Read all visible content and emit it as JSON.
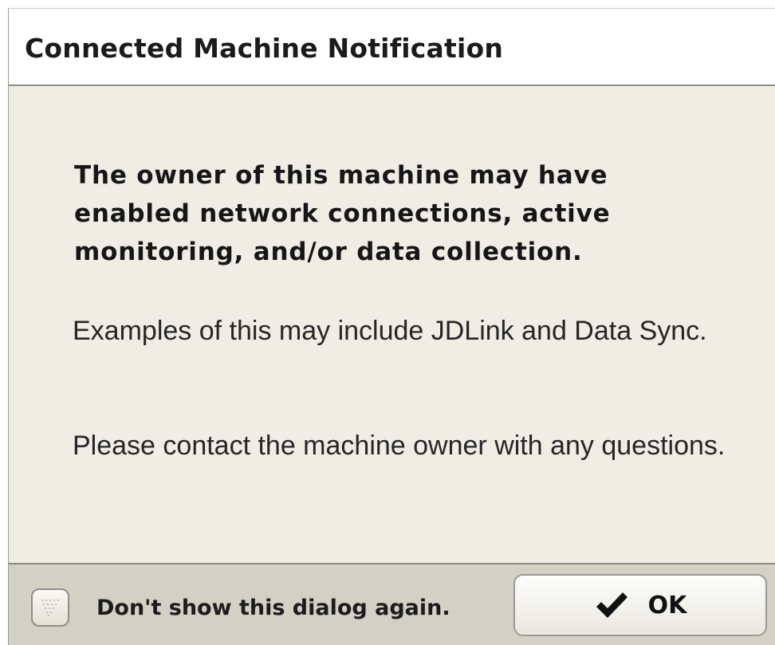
{
  "dialog": {
    "title": "Connected Machine Notification",
    "message_bold": "The owner of this machine may have enabled network connections, active monitoring, and/or data collection.",
    "message_examples": "Examples of this may include JDLink and Data Sync.",
    "message_contact": "Please contact the machine owner with any questions."
  },
  "footer": {
    "checkbox_label": "Don't show this dialog again.",
    "checkbox_checked": false,
    "ok_label": "OK",
    "ok_icon": "checkmark-icon"
  },
  "colors": {
    "body_background": "#efede4",
    "title_background": "#ffffff",
    "footer_background": "#d3d0c6"
  }
}
